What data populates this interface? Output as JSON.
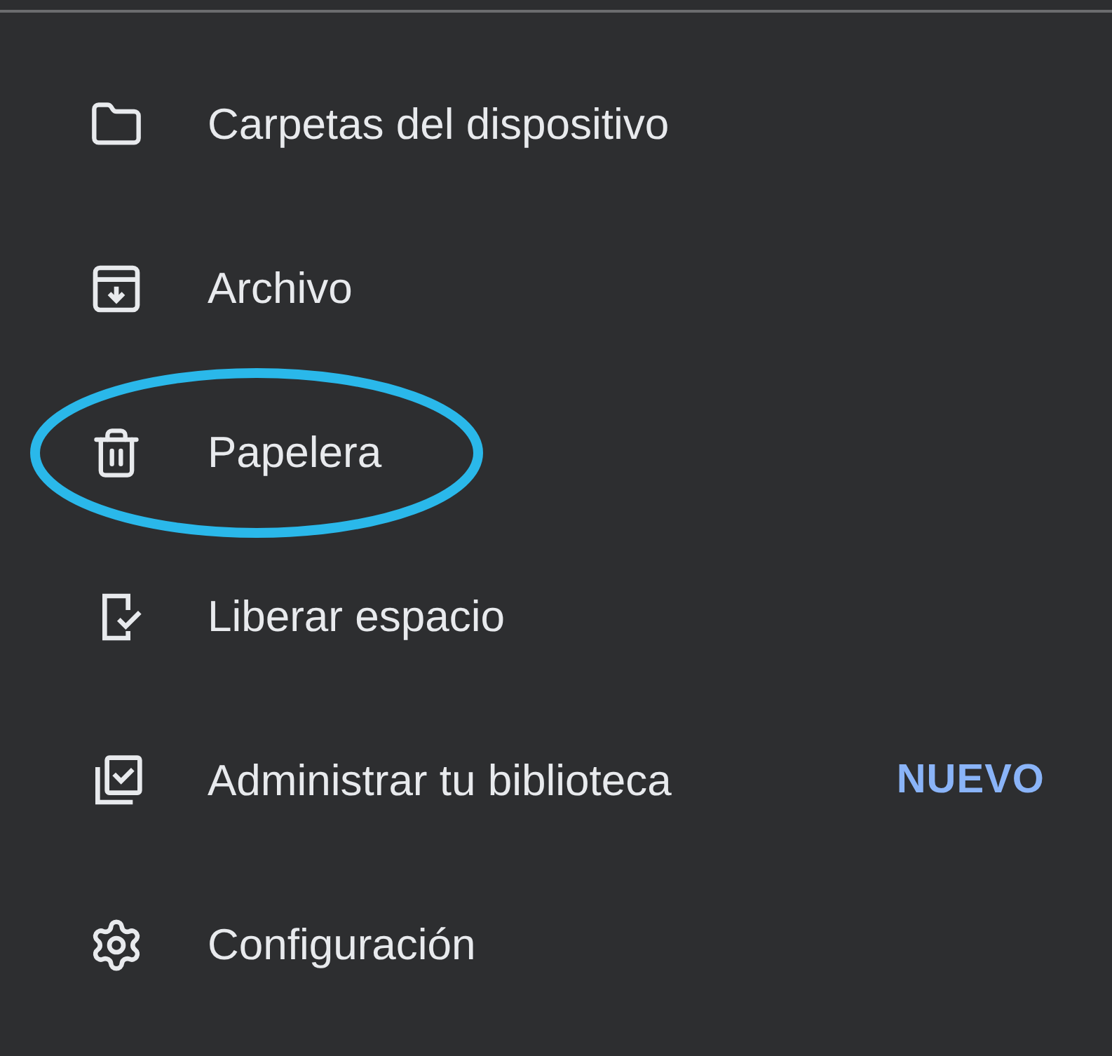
{
  "menu": {
    "items": [
      {
        "label": "Carpetas del dispositivo",
        "circled": false
      },
      {
        "label": "Archivo",
        "circled": false
      },
      {
        "label": "Papelera",
        "circled": true
      },
      {
        "label": "Liberar espacio",
        "circled": false
      },
      {
        "label": "Administrar tu biblioteca",
        "badge": "NUEVO",
        "circled": false
      },
      {
        "label": "Configuración",
        "circled": false
      }
    ]
  }
}
